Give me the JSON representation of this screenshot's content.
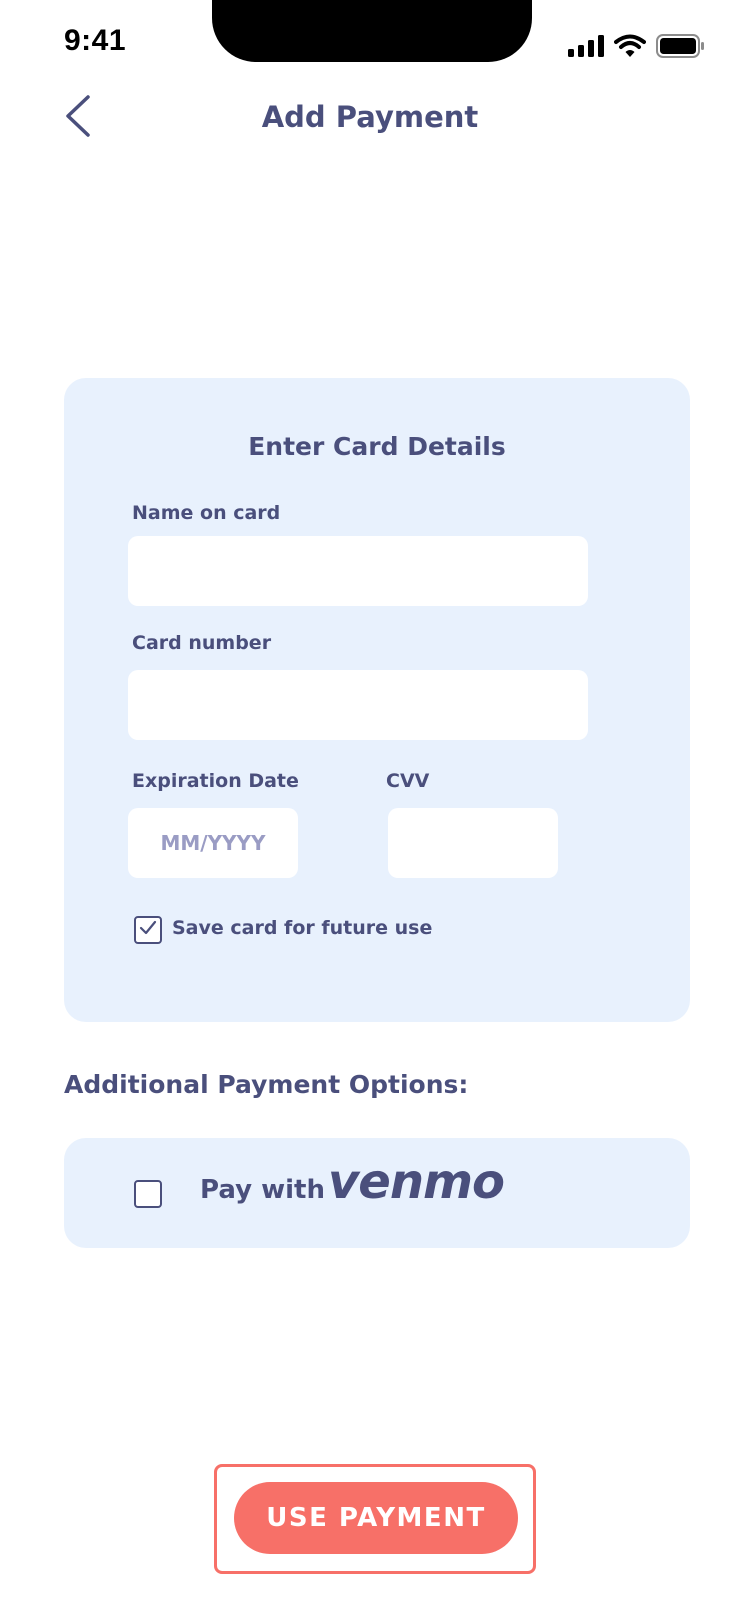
{
  "status_bar": {
    "time": "9:41"
  },
  "header": {
    "title": "Add Payment",
    "back_icon": "chevron-left-icon"
  },
  "card_form": {
    "heading": "Enter Card Details",
    "name_label": "Name on card",
    "name_value": "",
    "number_label": "Card number",
    "number_value": "",
    "expiration_label": "Expiration Date",
    "expiration_placeholder": "MM/YYYY",
    "cvv_label": "CVV",
    "cvv_value": "",
    "save_label": "Save card for future use",
    "save_checked": true
  },
  "additional": {
    "heading": "Additional Payment Options:",
    "venmo_text": "Pay with",
    "venmo_logo": "venmo",
    "venmo_checked": false
  },
  "cta": {
    "label": "USE PAYMENT"
  },
  "colors": {
    "text": "#4a4f7c",
    "panel": "#e8f1fd",
    "accent": "#f77068"
  }
}
